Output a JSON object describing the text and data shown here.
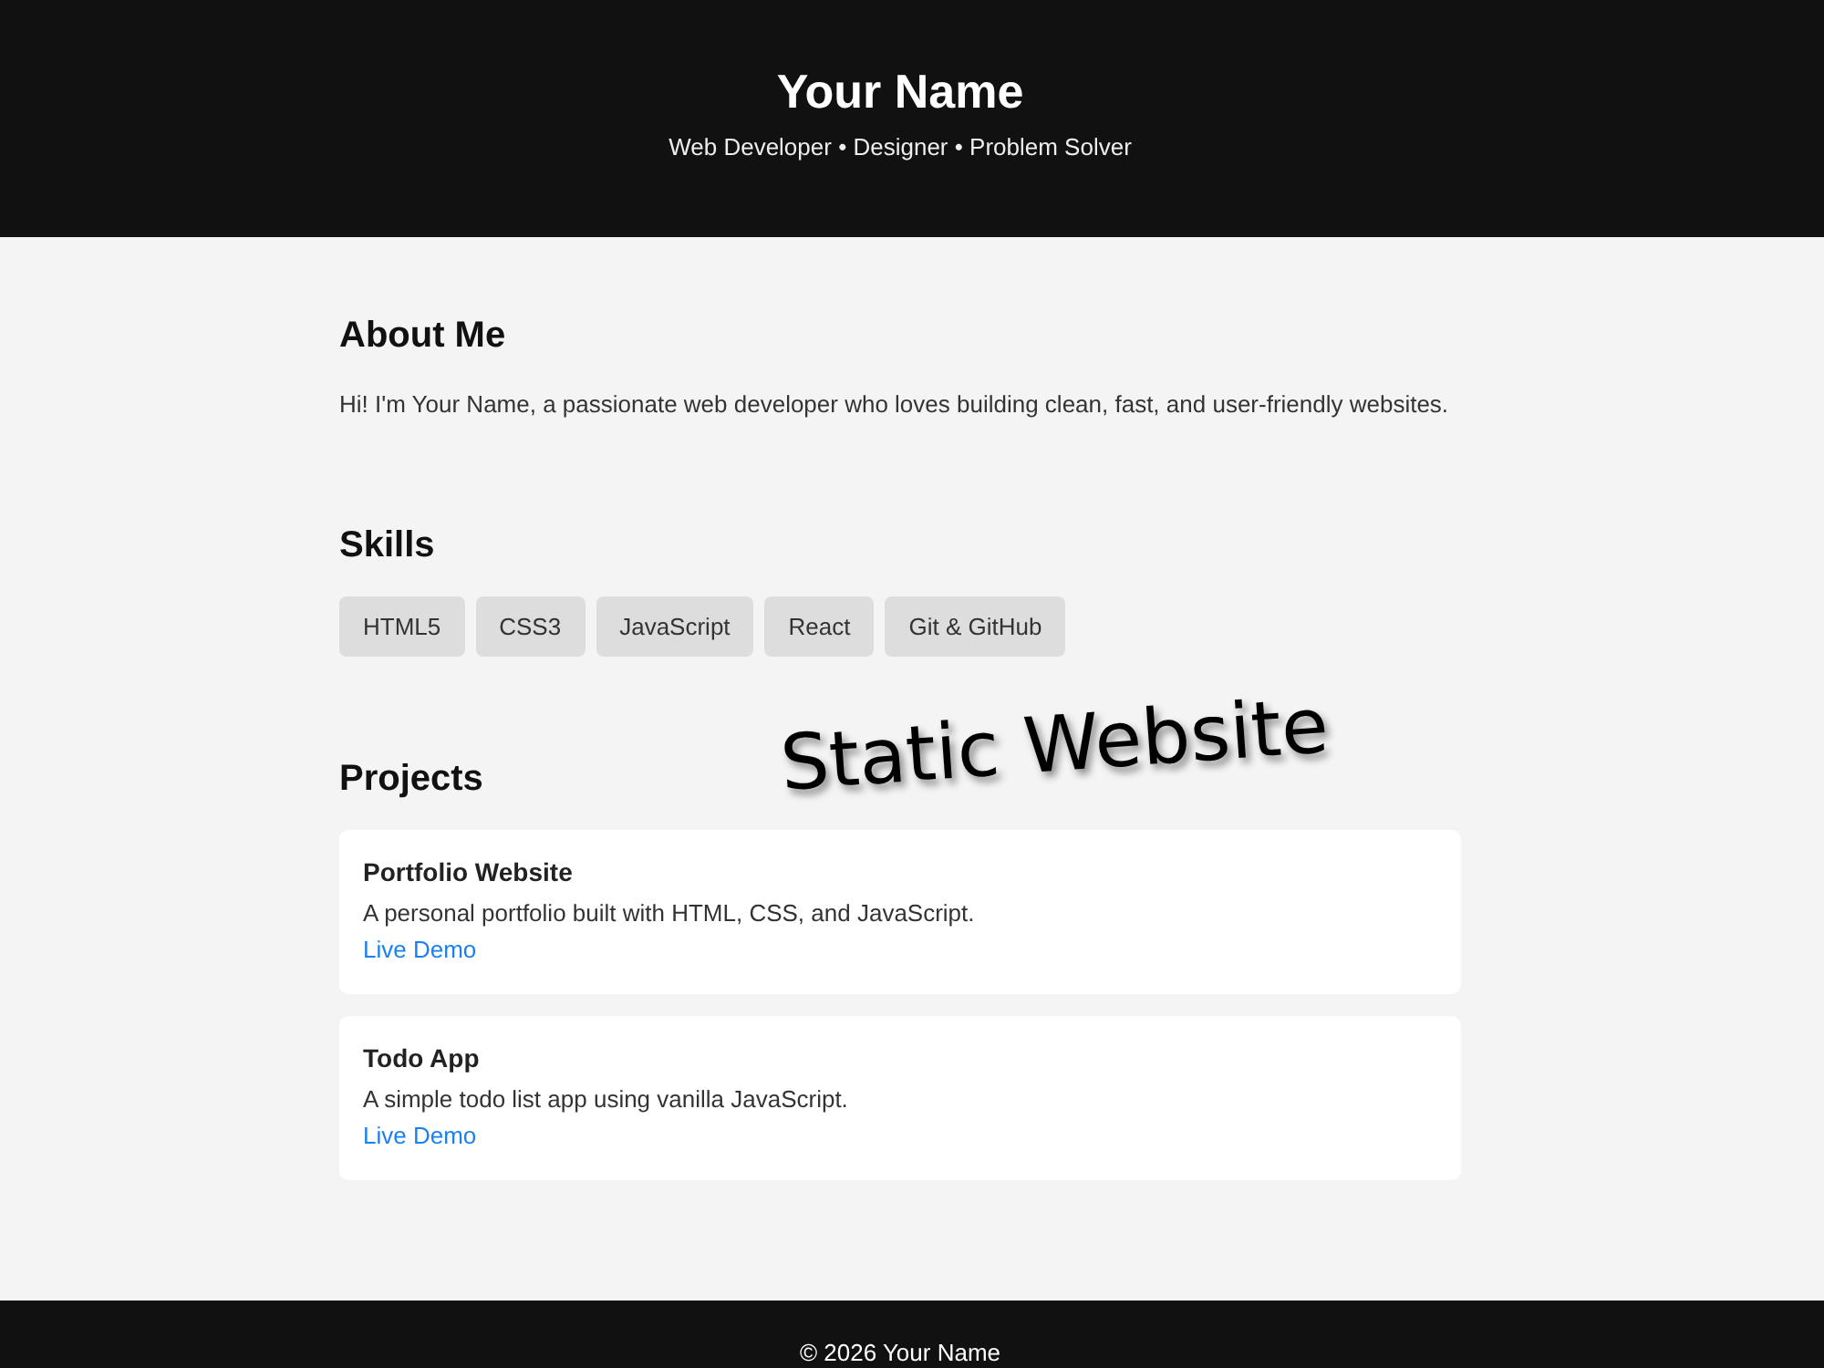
{
  "header": {
    "name": "Your Name",
    "tagline": "Web Developer • Designer • Problem Solver"
  },
  "sections": [
    {
      "kind": "text",
      "heading": "About Me",
      "text": "Hi! I'm Your Name, a passionate web developer who loves building clean, fast, and user-friendly websites."
    },
    {
      "kind": "chips",
      "heading": "Skills",
      "chips": [
        "HTML5",
        "CSS3",
        "JavaScript",
        "React",
        "Git & GitHub"
      ]
    },
    {
      "kind": "cards",
      "heading": "Projects",
      "cards": [
        {
          "title": "Portfolio Website",
          "description": "A personal portfolio built with HTML, CSS, and JavaScript.",
          "link": "Live Demo"
        },
        {
          "title": "Todo App",
          "description": "A simple todo list app using vanilla JavaScript.",
          "link": "Live Demo"
        }
      ]
    }
  ],
  "overlay_caption": "Static Website",
  "footer": {
    "text": "© 2026 Your Name"
  }
}
